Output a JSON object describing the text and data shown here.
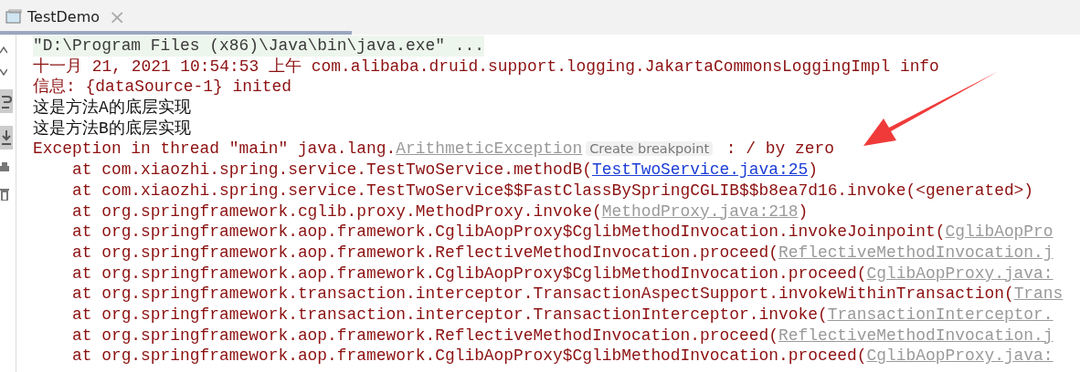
{
  "tab": {
    "title": "TestDemo",
    "close": "×",
    "selected": true
  },
  "console": [
    {
      "kind": "command",
      "segments": [
        {
          "kind": "text",
          "text": "\"D:\\Program Files (x86)\\Java\\bin\\java.exe\" ..."
        }
      ]
    },
    {
      "kind": "stderr",
      "segments": [
        {
          "kind": "text",
          "text": "十一月 21, 2021 10:54:53 上午 com.alibaba.druid.support.logging.JakartaCommonsLoggingImpl info"
        }
      ]
    },
    {
      "kind": "stderr",
      "segments": [
        {
          "kind": "text",
          "text": "信息: {dataSource-1} inited"
        }
      ]
    },
    {
      "kind": "stdout",
      "segments": [
        {
          "kind": "text",
          "text": "这是方法A的底层实现"
        }
      ]
    },
    {
      "kind": "stdout",
      "segments": [
        {
          "kind": "text",
          "text": "这是方法B的底层实现"
        }
      ]
    },
    {
      "kind": "stderr",
      "segments": [
        {
          "kind": "text",
          "text": "Exception in thread \"main\" java.lang."
        },
        {
          "kind": "source",
          "text": "ArithmeticException"
        },
        {
          "kind": "hint",
          "text": "Create breakpoint"
        },
        {
          "kind": "text",
          "text": " : / by zero"
        }
      ]
    },
    {
      "kind": "stderr",
      "segments": [
        {
          "kind": "text",
          "text": "    at com.xiaozhi.spring.service.TestTwoService.methodB("
        },
        {
          "kind": "link",
          "text": "TestTwoService.java:25"
        },
        {
          "kind": "text",
          "text": ")"
        }
      ]
    },
    {
      "kind": "stderr",
      "segments": [
        {
          "kind": "text",
          "text": "    at com.xiaozhi.spring.service.TestTwoService$$FastClassBySpringCGLIB$$b8ea7d16.invoke(<generated>)"
        }
      ]
    },
    {
      "kind": "stderr",
      "segments": [
        {
          "kind": "text",
          "text": "    at org.springframework.cglib.proxy.MethodProxy.invoke("
        },
        {
          "kind": "source",
          "text": "MethodProxy.java:218"
        },
        {
          "kind": "text",
          "text": ")"
        }
      ]
    },
    {
      "kind": "stderr",
      "segments": [
        {
          "kind": "text",
          "text": "    at org.springframework.aop.framework.CglibAopProxy$CglibMethodInvocation.invokeJoinpoint("
        },
        {
          "kind": "source",
          "text": "CglibAopPro"
        }
      ]
    },
    {
      "kind": "stderr",
      "segments": [
        {
          "kind": "text",
          "text": "    at org.springframework.aop.framework.ReflectiveMethodInvocation.proceed("
        },
        {
          "kind": "source",
          "text": "ReflectiveMethodInvocation.j"
        }
      ]
    },
    {
      "kind": "stderr",
      "segments": [
        {
          "kind": "text",
          "text": "    at org.springframework.aop.framework.CglibAopProxy$CglibMethodInvocation.proceed("
        },
        {
          "kind": "source",
          "text": "CglibAopProxy.java:"
        }
      ]
    },
    {
      "kind": "stderr",
      "segments": [
        {
          "kind": "text",
          "text": "    at org.springframework.transaction.interceptor.TransactionAspectSupport.invokeWithinTransaction("
        },
        {
          "kind": "source",
          "text": "Trans"
        }
      ]
    },
    {
      "kind": "stderr",
      "segments": [
        {
          "kind": "text",
          "text": "    at org.springframework.transaction.interceptor.TransactionInterceptor.invoke("
        },
        {
          "kind": "source",
          "text": "TransactionInterceptor."
        }
      ]
    },
    {
      "kind": "stderr",
      "segments": [
        {
          "kind": "text",
          "text": "    at org.springframework.aop.framework.ReflectiveMethodInvocation.proceed("
        },
        {
          "kind": "source",
          "text": "ReflectiveMethodInvocation.j"
        }
      ]
    },
    {
      "kind": "stderr",
      "segments": [
        {
          "kind": "text",
          "text": "    at org.springframework.aop.framework.CglibAopProxy$CglibMethodInvocation.proceed("
        },
        {
          "kind": "source",
          "text": "CglibAopProxy.java:"
        }
      ]
    }
  ]
}
